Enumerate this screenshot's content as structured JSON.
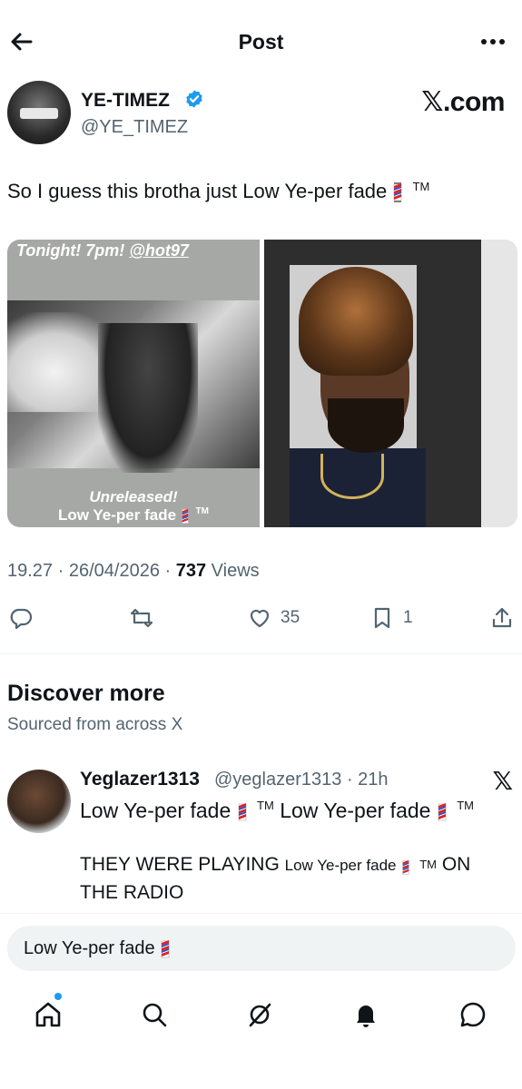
{
  "header": {
    "title": "Post",
    "back_icon": "arrow-left-icon",
    "more_icon": "more-dots-icon"
  },
  "author": {
    "name": "YE-TIMEZ",
    "handle": "@YE_TIMEZ",
    "source": "𝕏.com",
    "verified_color": "#1d9bf0"
  },
  "tweet": {
    "text": "So I guess this brotha just Low Ye-per fade",
    "tm": "TM",
    "images": [
      {
        "caption_top_prefix": "Tonight! 7pm! ",
        "caption_top_link": "@hot97",
        "caption_bottom_1": "Unreleased!",
        "caption_bottom_2": "Low Ye-per fade",
        "caption_bottom_tm": "TM"
      },
      {
        "kind": "barbershop-mirror-photo"
      }
    ]
  },
  "meta": {
    "time": "19.27",
    "date": "26/04/2026",
    "views_count": "737",
    "views_label": "Views"
  },
  "actions": {
    "reply": "",
    "repost": "",
    "like": "35",
    "bookmark": "1"
  },
  "discover": {
    "title": "Discover more",
    "subtitle": "Sourced from across X"
  },
  "recommended": {
    "name": "Yeglazer1313",
    "handle_time": "@yeglazer1313 · 21h",
    "source": "𝕏",
    "line1_a": "Low Ye-per fade",
    "line1_b": "Low Ye-per fade",
    "tm": "TM",
    "line2_prefix": "THEY WERE PLAYING ",
    "line2_small": "Low Ye-per fade",
    "line2_suffix": "ON THE RADIO"
  },
  "reply_box": {
    "value": "Low Ye-per fade"
  },
  "nav": {
    "items": [
      "home-icon",
      "search-icon",
      "grok-icon",
      "notifications-icon",
      "messages-icon"
    ],
    "accent": "#1d9bf0"
  }
}
